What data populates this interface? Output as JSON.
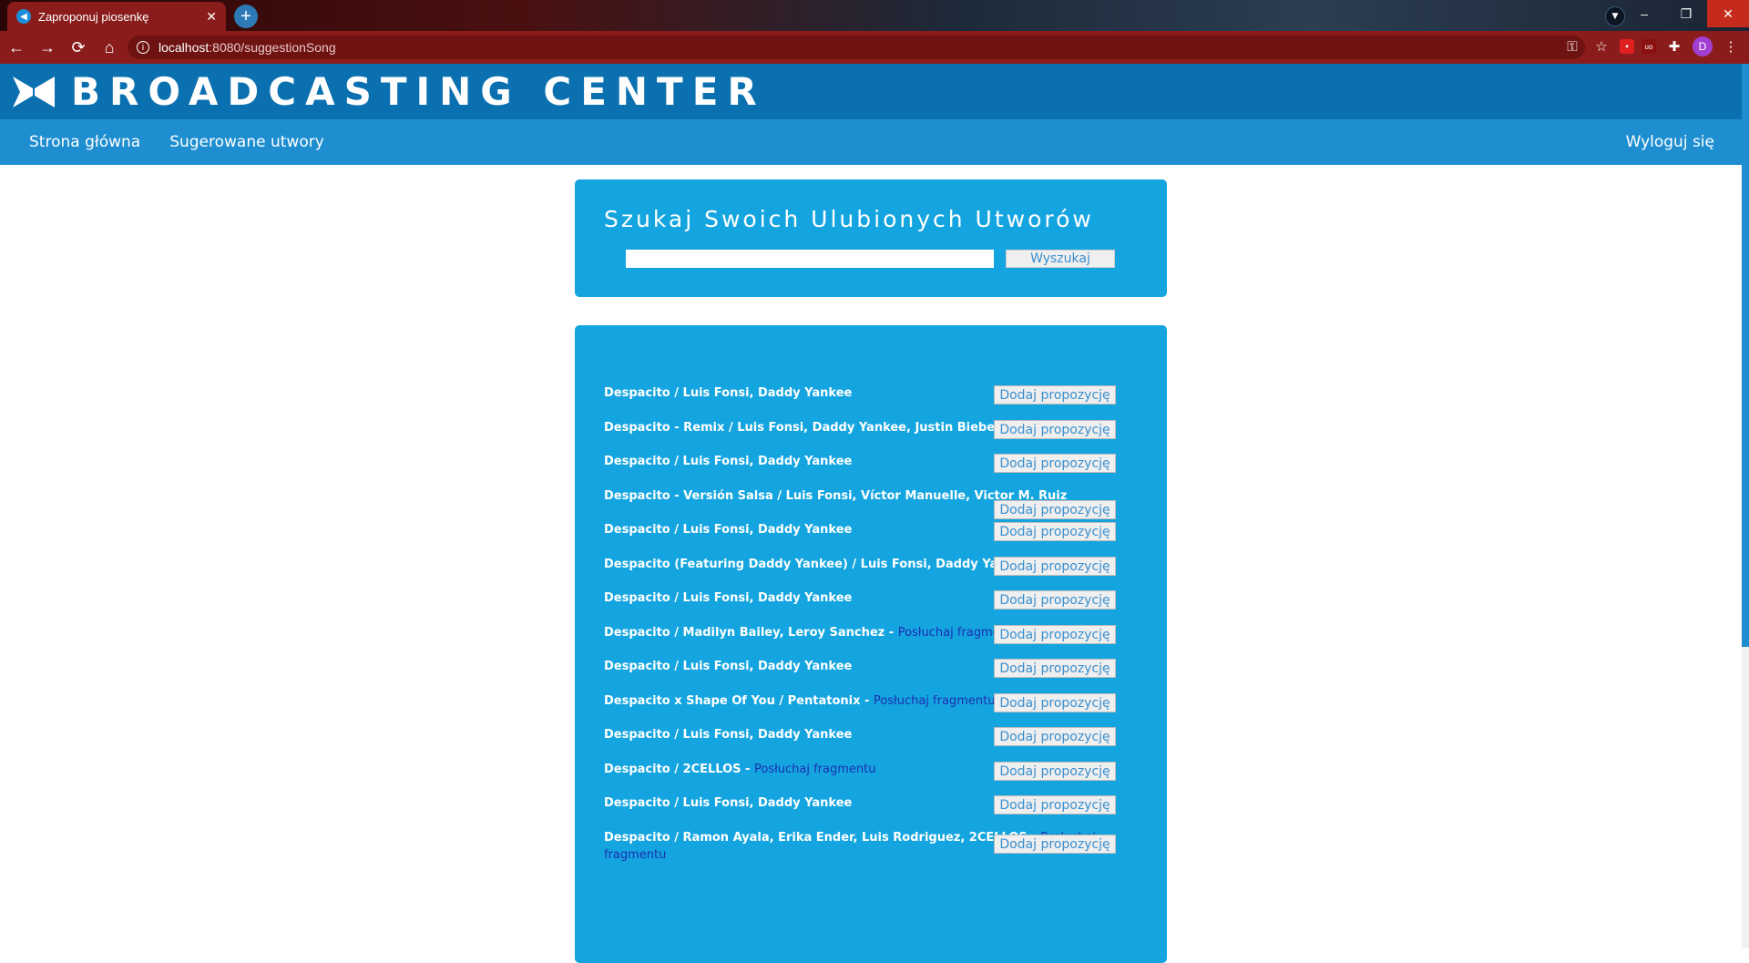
{
  "browser": {
    "tab_title": "Zaproponuj piosenkę",
    "url_host": "localhost",
    "url_path": ":8080/suggestionSong",
    "avatar_letter": "D",
    "window_controls": [
      "–",
      "❐",
      "✕"
    ]
  },
  "site": {
    "brand": "BROADCASTING CENTER",
    "nav": {
      "home": "Strona główna",
      "suggested": "Sugerowane utwory",
      "logout": "Wyloguj się"
    },
    "search": {
      "title": "Szukaj Swoich Ulubionych Utworów",
      "input_value": "",
      "button": "Wyszukaj"
    },
    "results": [
      {
        "text": "Despacito / Luis Fonsi, Daddy Yankee",
        "listen": "",
        "button": "Dodaj propozycję"
      },
      {
        "text": "Despacito - Remix / Luis Fonsi, Daddy Yankee, Justin Bieber",
        "listen": "",
        "button": "Dodaj propozycję"
      },
      {
        "text": "Despacito / Luis Fonsi, Daddy Yankee",
        "listen": "",
        "button": "Dodaj propozycję"
      },
      {
        "text": "Despacito - Versión Salsa / Luis Fonsi, Víctor Manuelle, Victor M. Ruiz",
        "listen": "",
        "button": "Dodaj propozycję"
      },
      {
        "text": "Despacito / Luis Fonsi, Daddy Yankee",
        "listen": "",
        "button": "Dodaj propozycję"
      },
      {
        "text": "Despacito (Featuring Daddy Yankee) / Luis Fonsi, Daddy Yankee",
        "listen": "",
        "button": "Dodaj propozycję"
      },
      {
        "text": "Despacito / Luis Fonsi, Daddy Yankee",
        "listen": "",
        "button": "Dodaj propozycję"
      },
      {
        "text": "Despacito / Madilyn Bailey, Leroy Sanchez - ",
        "listen": "Posłuchaj fragmentu",
        "button": "Dodaj propozycję"
      },
      {
        "text": "Despacito / Luis Fonsi, Daddy Yankee",
        "listen": "",
        "button": "Dodaj propozycję"
      },
      {
        "text": "Despacito x Shape Of You / Pentatonix - ",
        "listen": "Posłuchaj fragmentu",
        "button": "Dodaj propozycję"
      },
      {
        "text": "Despacito / Luis Fonsi, Daddy Yankee",
        "listen": "",
        "button": "Dodaj propozycję"
      },
      {
        "text": "Despacito / 2CELLOS - ",
        "listen": "Posłuchaj fragmentu",
        "button": "Dodaj propozycję"
      },
      {
        "text": "Despacito / Luis Fonsi, Daddy Yankee",
        "listen": "",
        "button": "Dodaj propozycję"
      },
      {
        "text": "Despacito / Ramon Ayala, Erika Ender, Luis Rodriguez, 2CELLOS - ",
        "listen": "Posłuchaj fragmentu",
        "button": "Dodaj propozycję"
      }
    ]
  }
}
